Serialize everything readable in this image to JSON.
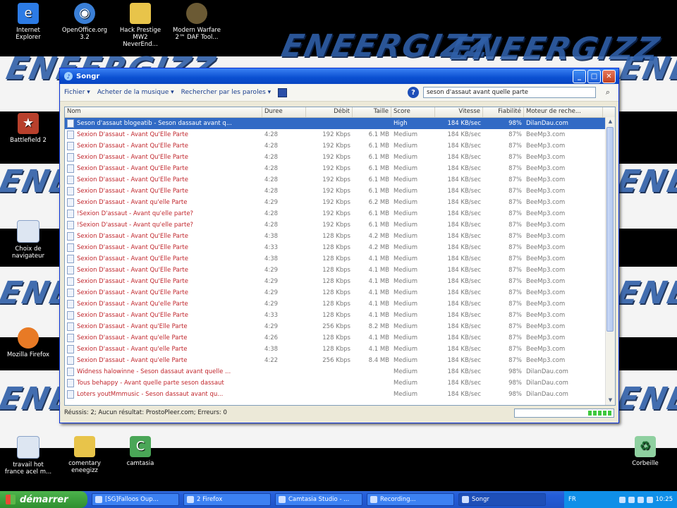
{
  "desktop": {
    "watermark": "ENEERGIZZ",
    "icons_left_top": [
      {
        "label": "Internet Explorer",
        "icon": "ie-icon",
        "color": "#2c7be5"
      },
      {
        "label": "OpenOffice.org 3.2",
        "icon": "openoffice-icon",
        "color": "#3a7fd6"
      },
      {
        "label": "Hack Prestige MW2 NeverEnd...",
        "icon": "folder-icon",
        "color": "#e8c44a"
      },
      {
        "label": "Modern Warfare 2™ DAF Tool...",
        "icon": "mw2-tool-icon",
        "color": "#6b5a34"
      }
    ],
    "icons_left_column": [
      {
        "label": "Battlefield 2",
        "icon": "battlefield-icon",
        "color": "#b8402c"
      },
      {
        "label": "Choix de navigateur",
        "icon": "browser-choice-icon",
        "color": "#dde6f2"
      },
      {
        "label": "Mozilla Firefox",
        "icon": "firefox-icon",
        "color": "#e87a25"
      }
    ],
    "icons_bottom": [
      {
        "label": "travail hot france acel m...",
        "icon": "document-icon",
        "color": "#dde6f2"
      },
      {
        "label": "comentary eneegizz",
        "icon": "folder-icon",
        "color": "#e8c44a"
      },
      {
        "label": "camtasia",
        "icon": "camtasia-icon",
        "color": "#4aa657"
      },
      {
        "label": "Corbeille",
        "icon": "recycle-bin-icon",
        "color": "#8fd0a0"
      }
    ]
  },
  "window": {
    "title": "Songr",
    "menu": {
      "fichier": "Fichier",
      "acheter": "Acheter de la musique",
      "rechercher": "Rechercher par les paroles"
    },
    "search": {
      "value": "seson d'assaut avant quelle parte"
    },
    "columns": [
      "Nom",
      "Duree",
      "Débit",
      "Taille",
      "Score",
      "Vitesse",
      "Fiabilité",
      "Moteur de reche..."
    ],
    "rows": [
      {
        "name": "Seson d'assaut blogeatib - Seson dassaut avant q...",
        "dur": "",
        "deb": "",
        "tai": "",
        "sco": "High",
        "vit": "184 KB/sec",
        "fia": "98%",
        "mot": "DilanDau.com",
        "selected": true
      },
      {
        "name": "Sexion D'assaut - Avant Qu'Elle Parte",
        "dur": "4:28",
        "deb": "192 Kbps",
        "tai": "6.1 MB",
        "sco": "Medium",
        "vit": "184 KB/sec",
        "fia": "87%",
        "mot": "BeeMp3.com"
      },
      {
        "name": "Sexion D'assaut - Avant Qu'Elle Parte",
        "dur": "4:28",
        "deb": "192 Kbps",
        "tai": "6.1 MB",
        "sco": "Medium",
        "vit": "184 KB/sec",
        "fia": "87%",
        "mot": "BeeMp3.com"
      },
      {
        "name": "Sexion D'assaut - Avant Qu'Elle Parte",
        "dur": "4:28",
        "deb": "192 Kbps",
        "tai": "6.1 MB",
        "sco": "Medium",
        "vit": "184 KB/sec",
        "fia": "87%",
        "mot": "BeeMp3.com"
      },
      {
        "name": "Sexion D'assaut - Avant Qu'Elle Parte",
        "dur": "4:28",
        "deb": "192 Kbps",
        "tai": "6.1 MB",
        "sco": "Medium",
        "vit": "184 KB/sec",
        "fia": "87%",
        "mot": "BeeMp3.com"
      },
      {
        "name": "Sexion D'assaut - Avant Qu'Elle Parte",
        "dur": "4:28",
        "deb": "192 Kbps",
        "tai": "6.1 MB",
        "sco": "Medium",
        "vit": "184 KB/sec",
        "fia": "87%",
        "mot": "BeeMp3.com"
      },
      {
        "name": "Sexion D'assaut - Avant Qu'Elle Parte",
        "dur": "4:28",
        "deb": "192 Kbps",
        "tai": "6.1 MB",
        "sco": "Medium",
        "vit": "184 KB/sec",
        "fia": "87%",
        "mot": "BeeMp3.com"
      },
      {
        "name": "Sexion D'assaut - Avant qu'elle Parte",
        "dur": "4:29",
        "deb": "192 Kbps",
        "tai": "6.2 MB",
        "sco": "Medium",
        "vit": "184 KB/sec",
        "fia": "87%",
        "mot": "BeeMp3.com"
      },
      {
        "name": "!Sexion D'assaut - Avant qu'elle parte?",
        "dur": "4:28",
        "deb": "192 Kbps",
        "tai": "6.1 MB",
        "sco": "Medium",
        "vit": "184 KB/sec",
        "fia": "87%",
        "mot": "BeeMp3.com"
      },
      {
        "name": "!Sexion D'assaut - Avant qu'elle parte?",
        "dur": "4:28",
        "deb": "192 Kbps",
        "tai": "6.1 MB",
        "sco": "Medium",
        "vit": "184 KB/sec",
        "fia": "87%",
        "mot": "BeeMp3.com"
      },
      {
        "name": "Sexion D'assaut - Avant Qu'Elle Parte",
        "dur": "4:38",
        "deb": "128 Kbps",
        "tai": "4.2 MB",
        "sco": "Medium",
        "vit": "184 KB/sec",
        "fia": "87%",
        "mot": "BeeMp3.com"
      },
      {
        "name": "Sexion D'assaut - Avant Qu'Elle Parte",
        "dur": "4:33",
        "deb": "128 Kbps",
        "tai": "4.2 MB",
        "sco": "Medium",
        "vit": "184 KB/sec",
        "fia": "87%",
        "mot": "BeeMp3.com"
      },
      {
        "name": "Sexion D'assaut - Avant Qu'Elle Parte",
        "dur": "4:38",
        "deb": "128 Kbps",
        "tai": "4.1 MB",
        "sco": "Medium",
        "vit": "184 KB/sec",
        "fia": "87%",
        "mot": "BeeMp3.com"
      },
      {
        "name": "Sexion D'assaut - Avant Qu'Elle Parte",
        "dur": "4:29",
        "deb": "128 Kbps",
        "tai": "4.1 MB",
        "sco": "Medium",
        "vit": "184 KB/sec",
        "fia": "87%",
        "mot": "BeeMp3.com"
      },
      {
        "name": "Sexion D'assaut - Avant Qu'Elle Parte",
        "dur": "4:29",
        "deb": "128 Kbps",
        "tai": "4.1 MB",
        "sco": "Medium",
        "vit": "184 KB/sec",
        "fia": "87%",
        "mot": "BeeMp3.com"
      },
      {
        "name": "Sexion D'assaut - Avant Qu'Elle Parte",
        "dur": "4:29",
        "deb": "128 Kbps",
        "tai": "4.1 MB",
        "sco": "Medium",
        "vit": "184 KB/sec",
        "fia": "87%",
        "mot": "BeeMp3.com"
      },
      {
        "name": "Sexion D'assaut - Avant Qu'elle Parte",
        "dur": "4:29",
        "deb": "128 Kbps",
        "tai": "4.1 MB",
        "sco": "Medium",
        "vit": "184 KB/sec",
        "fia": "87%",
        "mot": "BeeMp3.com"
      },
      {
        "name": "Sexion D'assaut - Avant Qu'Elle Parte",
        "dur": "4:33",
        "deb": "128 Kbps",
        "tai": "4.1 MB",
        "sco": "Medium",
        "vit": "184 KB/sec",
        "fia": "87%",
        "mot": "BeeMp3.com"
      },
      {
        "name": "Sexion D'assaut - Avant qu'Elle Parte",
        "dur": "4:29",
        "deb": "256 Kbps",
        "tai": "8.2 MB",
        "sco": "Medium",
        "vit": "184 KB/sec",
        "fia": "87%",
        "mot": "BeeMp3.com"
      },
      {
        "name": "Sexion D'assaut - Avant qu'elle Parte",
        "dur": "4:26",
        "deb": "128 Kbps",
        "tai": "4.1 MB",
        "sco": "Medium",
        "vit": "184 KB/sec",
        "fia": "87%",
        "mot": "BeeMp3.com"
      },
      {
        "name": "Sexion D'assaut - Avant qu'elle Parte",
        "dur": "4:38",
        "deb": "128 Kbps",
        "tai": "4.1 MB",
        "sco": "Medium",
        "vit": "184 KB/sec",
        "fia": "87%",
        "mot": "BeeMp3.com"
      },
      {
        "name": "Sexion D'assaut - Avant qu'elle Parte",
        "dur": "4:22",
        "deb": "256 Kbps",
        "tai": "8.4 MB",
        "sco": "Medium",
        "vit": "184 KB/sec",
        "fia": "87%",
        "mot": "BeeMp3.com"
      },
      {
        "name": "Widness halowinne - Seson dassaut avant quelle ...",
        "dur": "",
        "deb": "",
        "tai": "",
        "sco": "Medium",
        "vit": "184 KB/sec",
        "fia": "98%",
        "mot": "DilanDau.com"
      },
      {
        "name": "Tous behappy - Avant quelle parte seson dassaut",
        "dur": "",
        "deb": "",
        "tai": "",
        "sco": "Medium",
        "vit": "184 KB/sec",
        "fia": "98%",
        "mot": "DilanDau.com"
      },
      {
        "name": "Loters youtMmmusic - Seson dassaut avant qu...",
        "dur": "",
        "deb": "",
        "tai": "",
        "sco": "Medium",
        "vit": "184 KB/sec",
        "fia": "98%",
        "mot": "DilanDau.com"
      }
    ],
    "status": "Réussis: 2; Aucun résultat: ProstoPleer.com; Erreurs: 0",
    "progress": 0.25
  },
  "taskbar": {
    "start": "démarrer",
    "tasks": [
      "[SG]Falloos Oup...",
      "2 Firefox",
      "Camtasia Studio - ...",
      "Recording...",
      "Songr"
    ],
    "lang": "FR",
    "clock": "10:25"
  }
}
